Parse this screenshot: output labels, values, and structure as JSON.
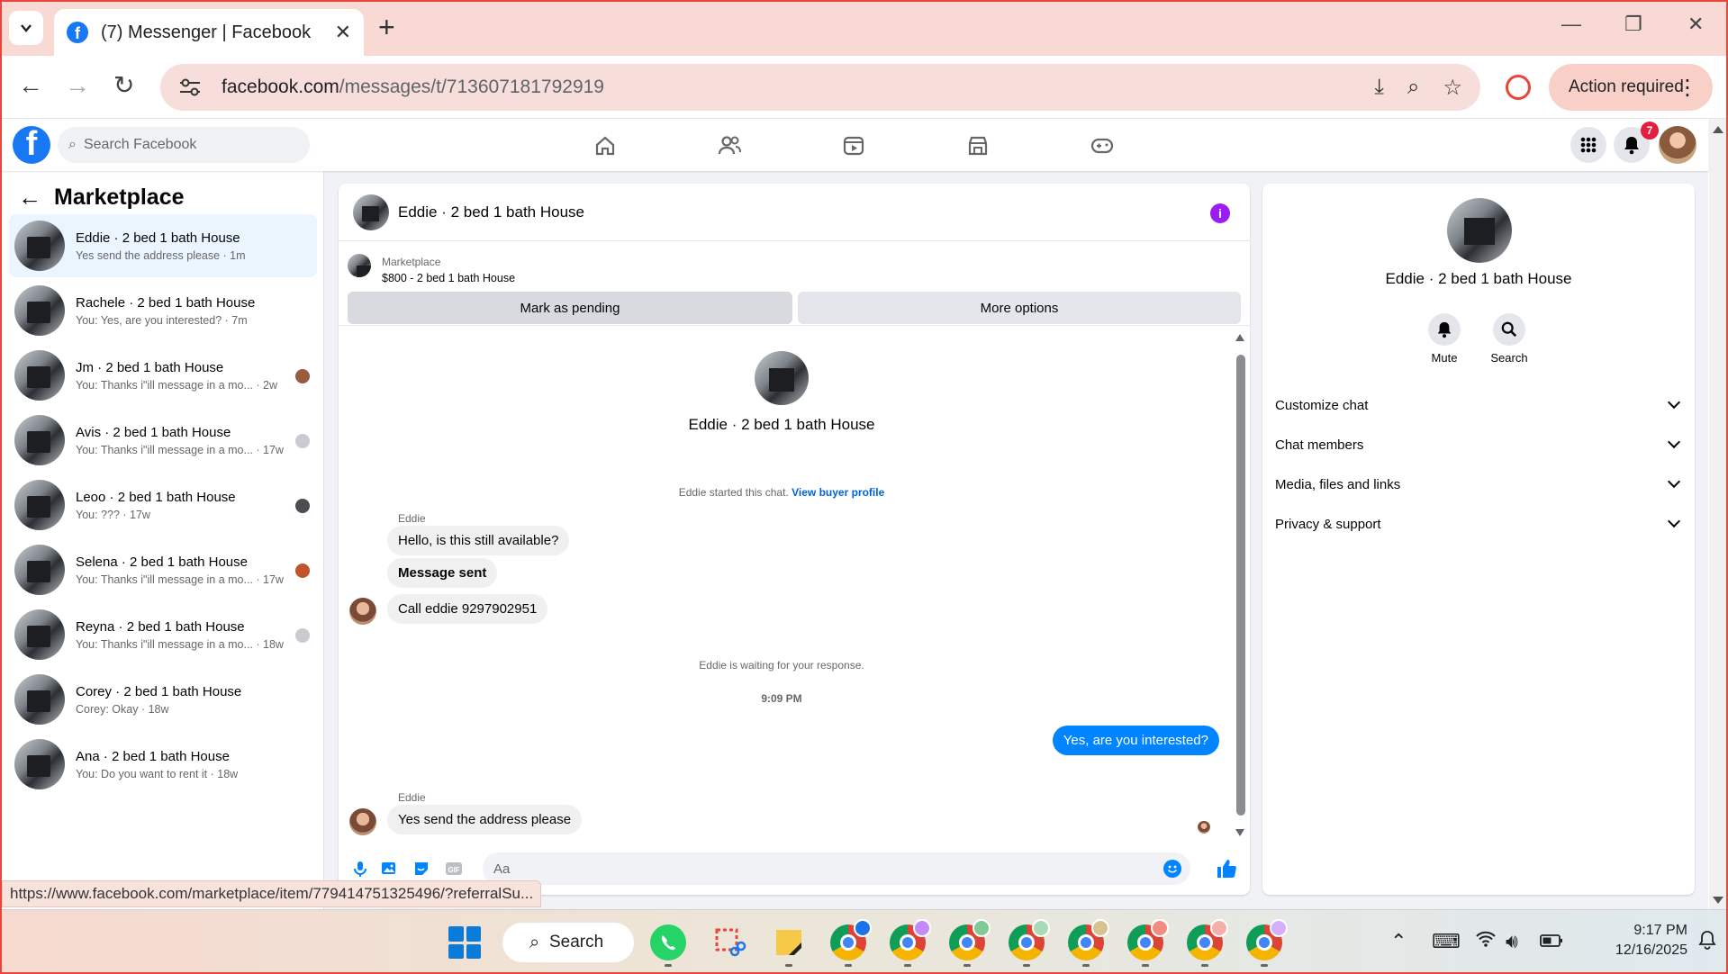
{
  "browser": {
    "tab_title": "(7) Messenger | Facebook",
    "url_host": "facebook.com",
    "url_path": "/messages/t/713607181792919",
    "action_required": "Action required",
    "status_url": "https://www.facebook.com/marketplace/item/779414751325496/?referralSu..."
  },
  "fb": {
    "search_placeholder": "Search Facebook",
    "notification_count": "7"
  },
  "left": {
    "title": "Marketplace",
    "conversations": [
      {
        "name": "Eddie · 2 bed 1 bath House",
        "preview": "Yes send the address please · 1m"
      },
      {
        "name": "Rachele · 2 bed 1 bath House",
        "preview": "You: Yes, are you interested? · 7m"
      },
      {
        "name": "Jm · 2 bed 1 bath House",
        "preview": "You: Thanks i\"ill message in a mo... · 2w"
      },
      {
        "name": "Avis · 2 bed 1 bath House",
        "preview": "You: Thanks i\"ill message in a mo... · 17w"
      },
      {
        "name": "Leoo · 2 bed 1 bath House",
        "preview": "You: ??? · 17w"
      },
      {
        "name": "Selena · 2 bed 1 bath House",
        "preview": "You: Thanks i\"ill message in a mo... · 17w"
      },
      {
        "name": "Reyna · 2 bed 1 bath House",
        "preview": "You: Thanks i\"ill message in a mo... · 18w"
      },
      {
        "name": "Corey · 2 bed 1 bath House",
        "preview": "Corey: Okay · 18w"
      },
      {
        "name": "Ana · 2 bed 1 bath House",
        "preview": "You: Do you want to rent it · 18w"
      }
    ]
  },
  "chat": {
    "title": "Eddie · 2 bed 1 bath House",
    "marketplace_label": "Marketplace",
    "item": "$800 - 2 bed 1 bath House",
    "btn_pending": "Mark as pending",
    "btn_more": "More options",
    "profile_name": "Eddie · 2 bed 1 bath House",
    "started_text": "Eddie started this chat.",
    "started_link": "View buyer profile",
    "sender1": "Eddie",
    "msg1": "Hello, is this still available?",
    "msg2": "Message sent",
    "msg3": "Call eddie 9297902951",
    "waiting": "Eddie is waiting for your response.",
    "time": "9:09 PM",
    "msg_mine": "Yes, are you interested?",
    "sender2": "Eddie",
    "msg4": "Yes send the address please",
    "input_placeholder": "Aa"
  },
  "details": {
    "name": "Eddie · 2 bed 1 bath House",
    "mute": "Mute",
    "search": "Search",
    "rows": [
      "Customize chat",
      "Chat members",
      "Media, files and links",
      "Privacy & support"
    ]
  },
  "taskbar": {
    "search": "Search",
    "time": "9:17 PM",
    "date": "12/16/2025"
  },
  "colors": {
    "fb_blue": "#1877f2",
    "messenger_blue": "#0084ff",
    "info_purple": "#9b1df2",
    "chrome_tab_bg": "#f8d9d3"
  }
}
